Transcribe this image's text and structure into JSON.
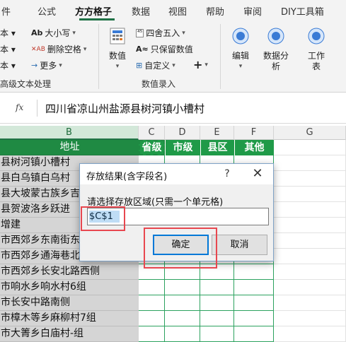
{
  "ribbon": {
    "tabs": [
      "件",
      "公式",
      "方方格子",
      "数据",
      "视图",
      "帮助",
      "审阅",
      "DIY工具箱"
    ],
    "active_tab": "方方格子",
    "text_group": {
      "left_items": [
        "本 ▾",
        "本 ▾",
        "本 ▾"
      ],
      "items": [
        {
          "icon": "Ab",
          "label": "大小写"
        },
        {
          "icon": "✕AB",
          "label": "删除空格"
        },
        {
          "icon": "→",
          "label": "更多"
        }
      ],
      "label": "高级文本处理"
    },
    "number_group": {
      "big_button": "数值",
      "items": [
        {
          "icon": "⁴⁵",
          "label": "四舍五入"
        },
        {
          "icon": "A≈",
          "label": "只保留数值"
        },
        {
          "icon": "⊞",
          "label": "自定义"
        }
      ],
      "plus": "+",
      "label": "数值录入"
    },
    "edit_buttons": [
      "编辑",
      "数据分析",
      "工作表"
    ]
  },
  "formula_bar": {
    "fx": "fx",
    "value": "四川省凉山州盐源县树河镇小槽村"
  },
  "columns": [
    "B",
    "C",
    "D",
    "E",
    "F",
    "G"
  ],
  "sheet": {
    "header": {
      "address": "地址",
      "province": "省级",
      "city": "市级",
      "county": "县区",
      "other": "其他"
    },
    "rows": [
      "县树河镇小槽村",
      "县白乌镇白乌村",
      "县大坡蒙古族乡吉",
      "县贺波洛乡跃进",
      "增建",
      "市西郊乡东南街东",
      "市西郊乡通海巷北",
      "市西郊乡长安北路西侧",
      "市响水乡响水村6组",
      "市长安中路南侧",
      "市樟木等乡麻柳村7组",
      "市大箐乡白庙村-组"
    ]
  },
  "dialog": {
    "title": "存放结果(含字段名)",
    "help": "?",
    "close": "✕",
    "prompt": "请选择存放区域(只需一个单元格)",
    "input_value": "$C$1",
    "ok_label": "确定",
    "cancel_label": "取消"
  },
  "colors": {
    "accent_green": "#1f8a43",
    "header_green": "#1f9a48",
    "highlight_red": "#e8474f",
    "dialog_focus_blue": "#0078d7"
  }
}
